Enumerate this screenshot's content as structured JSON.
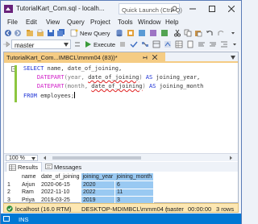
{
  "window": {
    "title": "TutorialKart_Com.sql - localh...",
    "quick_launch_placeholder": "Quick Launch (Ctrl+Q)"
  },
  "menu": [
    "File",
    "Edit",
    "View",
    "Query",
    "Project",
    "Tools",
    "Window",
    "Help"
  ],
  "toolbar": {
    "new_query_label": "New Query"
  },
  "toolbar2": {
    "database": "master",
    "execute_label": "Execute"
  },
  "editor": {
    "tab_title": "TutorialKart_Com...IMBCL\\mmm04 (83))*",
    "code": {
      "l1_kw": "SELECT",
      "l1_rest": " name, date_of_joining,",
      "l2_fn": "DATEPART",
      "l2_a": "(year, ",
      "l2_b": "date_of_joining",
      "l2_c": ") ",
      "l2_as": "AS",
      "l2_d": " joining_year,",
      "l3_fn": "DATEPART",
      "l3_a": "(month, ",
      "l3_b": "date_of_joining",
      "l3_c": ") ",
      "l3_as": "AS",
      "l3_d": " joining_month",
      "l4_kw": "FROM",
      "l4_rest": " employees;"
    },
    "zoom": "100 %"
  },
  "results_tabs": {
    "results": "Results",
    "messages": "Messages"
  },
  "results": {
    "columns": [
      "name",
      "date_of_joining",
      "joining_year",
      "joining_month"
    ],
    "rows": [
      [
        "1",
        "Arjun",
        "2020-06-15",
        "2020",
        "6"
      ],
      [
        "2",
        "Ram",
        "2022-11-10",
        "2022",
        "11"
      ],
      [
        "3",
        "Priya",
        "2019-03-25",
        "2019",
        "3"
      ]
    ]
  },
  "status": {
    "message": "Query executed successfully.",
    "server": "localhost (16.0 RTM)",
    "machine": "DESKTOP-MDIMBCL\\mmm04 (...",
    "database": "master",
    "time": "00:00:00",
    "rows": "3 rows"
  },
  "bottom": {
    "mode": "INS"
  },
  "colors": {
    "accent": "#0078d4",
    "tab": "#f5cc84",
    "status": "#fde7b2",
    "selection": "#99c9f2"
  }
}
